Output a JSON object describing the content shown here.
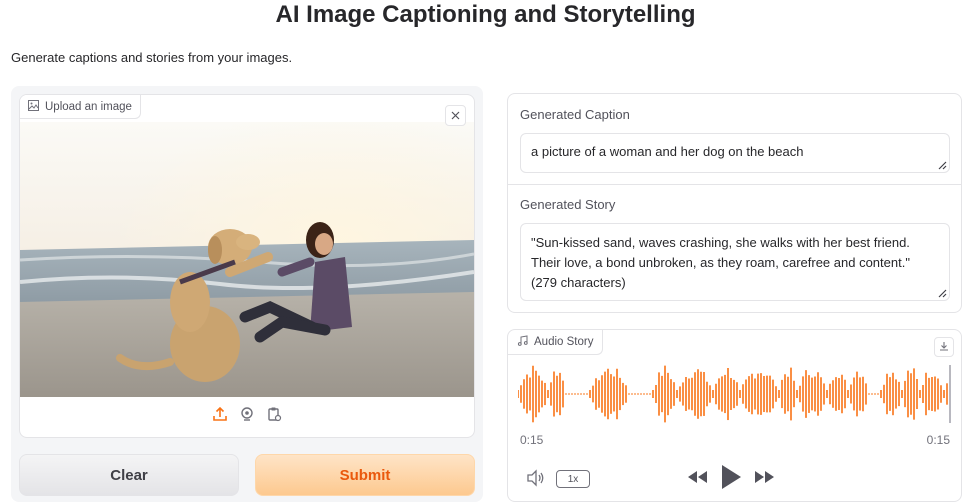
{
  "header": {
    "title": "AI Image Captioning and Storytelling",
    "subtitle": "Generate captions and stories from your images."
  },
  "image_input": {
    "label": "Upload an image",
    "label_icon": "image-icon",
    "toolbar_icons": [
      "upload-icon",
      "webcam-icon",
      "clipboard-icon"
    ]
  },
  "buttons": {
    "clear_label": "Clear",
    "submit_label": "Submit"
  },
  "caption": {
    "label": "Generated Caption",
    "value": "a picture of a woman and her dog on the beach"
  },
  "story": {
    "label": "Generated Story",
    "value": "\"Sun-kissed sand, waves crashing, she walks with her best friend. Their love, a bond unbroken, as they roam, carefree and content.\" (279 characters)"
  },
  "audio": {
    "label": "Audio Story",
    "label_icon": "music-note-icon",
    "current_time": "0:15",
    "duration": "0:15",
    "speed": "1x"
  },
  "colors": {
    "accent": "#f97316",
    "submit_text": "#ea580c",
    "border": "#e4e4e7"
  }
}
